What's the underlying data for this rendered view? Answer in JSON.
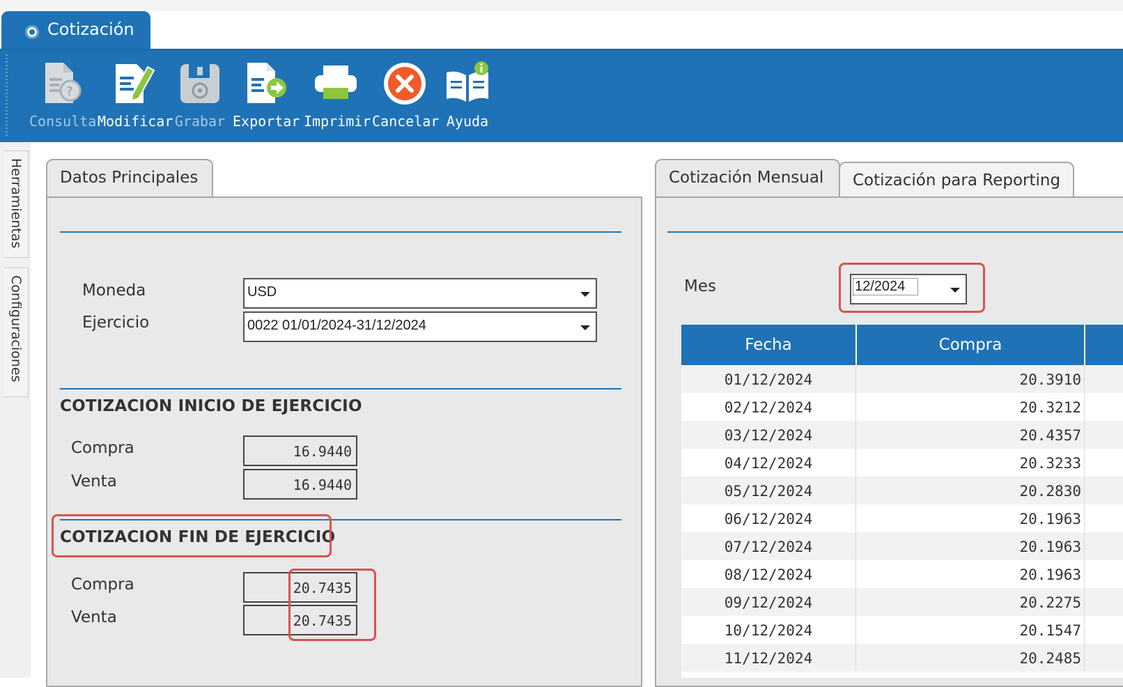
{
  "window": {
    "tab_title": "Cotización"
  },
  "toolbar": {
    "buttons": [
      {
        "label": "Consulta",
        "icon": "document-query-icon",
        "enabled": false
      },
      {
        "label": "Modificar",
        "icon": "document-edit-icon",
        "enabled": true
      },
      {
        "label": "Grabar",
        "icon": "save-disk-icon",
        "enabled": false
      },
      {
        "label": "Exportar",
        "icon": "document-export-icon",
        "enabled": true
      },
      {
        "label": "Imprimir",
        "icon": "printer-icon",
        "enabled": true
      },
      {
        "label": "Cancelar",
        "icon": "cancel-x-icon",
        "enabled": true
      },
      {
        "label": "Ayuda",
        "icon": "help-book-icon",
        "enabled": true
      }
    ]
  },
  "sidebar": {
    "tabs": [
      "Herramientas",
      "Configuraciones"
    ]
  },
  "left_panel": {
    "tab": "Datos Principales",
    "moneda_label": "Moneda",
    "moneda_value": "USD",
    "ejercicio_label": "Ejercicio",
    "ejercicio_value": "0022 01/01/2024-31/12/2024",
    "inicio": {
      "title": "COTIZACION INICIO DE EJERCICIO",
      "compra_label": "Compra",
      "compra_value": "16.9440",
      "venta_label": "Venta",
      "venta_value": "16.9440"
    },
    "fin": {
      "title": "COTIZACION FIN DE EJERCICIO",
      "compra_label": "Compra",
      "compra_value": "20.7435",
      "venta_label": "Venta",
      "venta_value": "20.7435"
    }
  },
  "right_panel": {
    "tabs": [
      "Cotización Mensual",
      "Cotización para Reporting"
    ],
    "mes_label": "Mes",
    "mes_value": "12/2024",
    "grid": {
      "columns": [
        "Fecha",
        "Compra"
      ],
      "rows": [
        [
          "01/12/2024",
          "20.3910"
        ],
        [
          "02/12/2024",
          "20.3212"
        ],
        [
          "03/12/2024",
          "20.4357"
        ],
        [
          "04/12/2024",
          "20.3233"
        ],
        [
          "05/12/2024",
          "20.2830"
        ],
        [
          "06/12/2024",
          "20.1963"
        ],
        [
          "07/12/2024",
          "20.1963"
        ],
        [
          "08/12/2024",
          "20.1963"
        ],
        [
          "09/12/2024",
          "20.2275"
        ],
        [
          "10/12/2024",
          "20.1547"
        ],
        [
          "11/12/2024",
          "20.2485"
        ]
      ]
    }
  },
  "colors": {
    "accent": "#1f72b5",
    "highlight": "#d9534f",
    "panel": "#e9e9e9"
  }
}
